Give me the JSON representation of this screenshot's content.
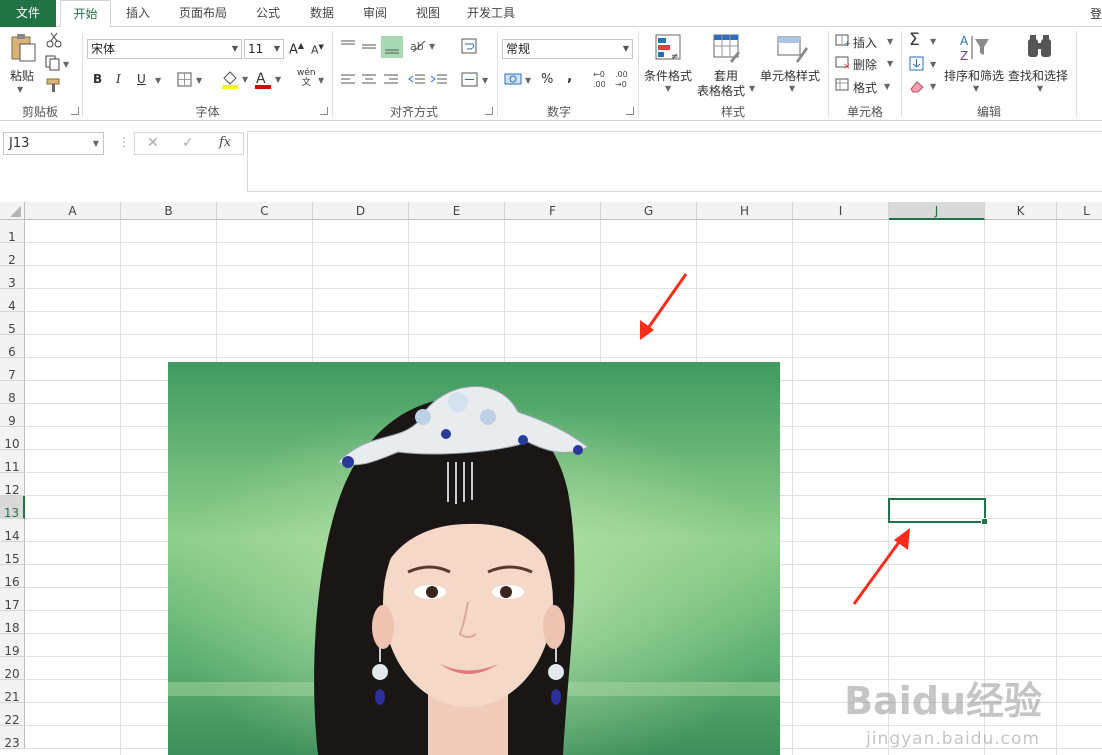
{
  "tabs": [
    {
      "label": "文件",
      "key": "file"
    },
    {
      "label": "开始",
      "key": "home",
      "active": true
    },
    {
      "label": "插入",
      "key": "insert"
    },
    {
      "label": "页面布局",
      "key": "pagelayout"
    },
    {
      "label": "公式",
      "key": "formulas"
    },
    {
      "label": "数据",
      "key": "data"
    },
    {
      "label": "审阅",
      "key": "review"
    },
    {
      "label": "视图",
      "key": "view"
    },
    {
      "label": "开发工具",
      "key": "developer"
    }
  ],
  "login_label": "登",
  "ribbon": {
    "clipboard": {
      "group_label": "剪贴板",
      "paste_label": "粘贴"
    },
    "font": {
      "group_label": "字体",
      "font_name": "宋体",
      "font_size": "11",
      "bold": "B",
      "italic": "I",
      "underline": "U",
      "font_color_letter": "A",
      "phonetic_top": "wén",
      "phonetic_bottom": "文"
    },
    "alignment": {
      "group_label": "对齐方式"
    },
    "number": {
      "group_label": "数字",
      "format": "常规",
      "percent": "%",
      "comma": ","
    },
    "styles": {
      "group_label": "样式",
      "conditional": "条件格式",
      "table_format_1": "套用",
      "table_format_2": "表格格式",
      "cell_styles": "单元格样式"
    },
    "cells": {
      "group_label": "单元格",
      "insert": "插入",
      "delete": "删除",
      "format": "格式"
    },
    "editing": {
      "group_label": "编辑",
      "sort_filter": "排序和筛选",
      "find_select": "查找和选择"
    }
  },
  "formula_bar": {
    "name_box": "J13",
    "fx": "fx",
    "formula": ""
  },
  "columns": [
    "A",
    "B",
    "C",
    "D",
    "E",
    "F",
    "G",
    "H",
    "I",
    "J",
    "K",
    "L"
  ],
  "selected_column": "J",
  "rows": [
    "1",
    "2",
    "3",
    "4",
    "5",
    "6",
    "7",
    "8",
    "9",
    "10",
    "11",
    "12",
    "13",
    "14",
    "15",
    "16",
    "17",
    "18",
    "19",
    "20",
    "21",
    "22",
    "23"
  ],
  "selected_row": "13",
  "selected_cell": "J13",
  "colors": {
    "accent": "#217346",
    "arrow": "#ff2a1a"
  },
  "watermark": {
    "main": "Baidu经验",
    "sub": "jingyan.baidu.com"
  }
}
